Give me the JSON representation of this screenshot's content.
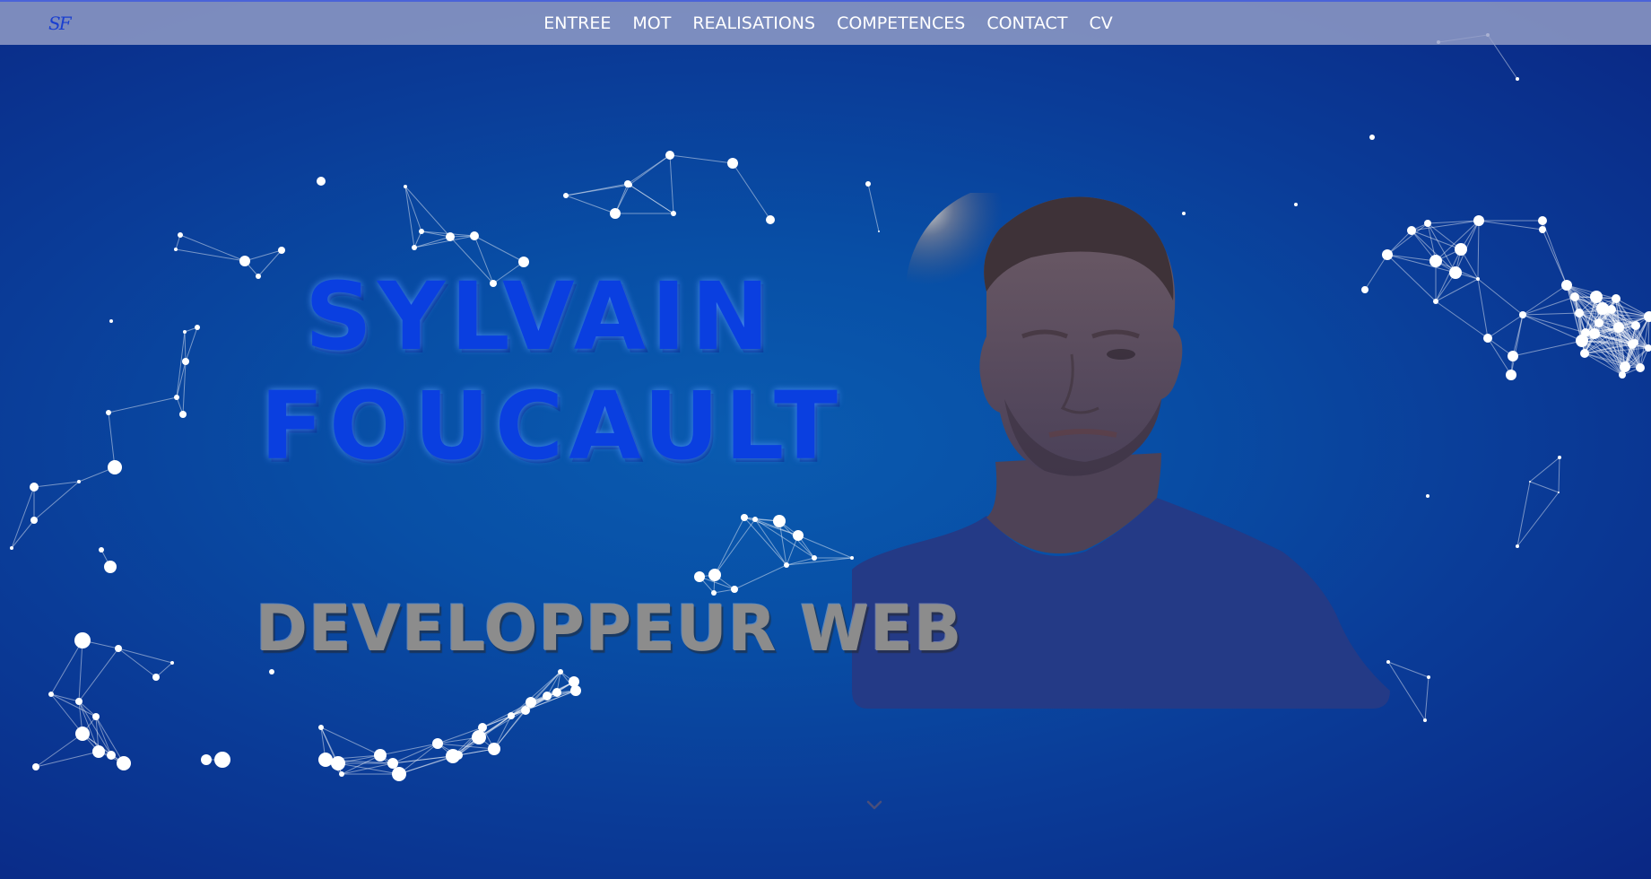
{
  "navbar": {
    "logo": "SF",
    "items": [
      {
        "label": "ENTREE"
      },
      {
        "label": "MOT"
      },
      {
        "label": "REALISATIONS"
      },
      {
        "label": "COMPETENCES"
      },
      {
        "label": "CONTACT"
      },
      {
        "label": "CV"
      }
    ]
  },
  "hero": {
    "first_name": "SYLVAIN",
    "last_name": "FOUCAULT",
    "job_title": "DEVELOPPEUR WEB",
    "scroll_icon": "chevron-down-icon",
    "portrait_icon": "portrait-photo"
  },
  "colors": {
    "background": "#0a4fa6",
    "navbar": "#96a0c8",
    "name": "#0a3fe0",
    "job_title": "#8c8c8c",
    "particles": "#ffffff"
  }
}
